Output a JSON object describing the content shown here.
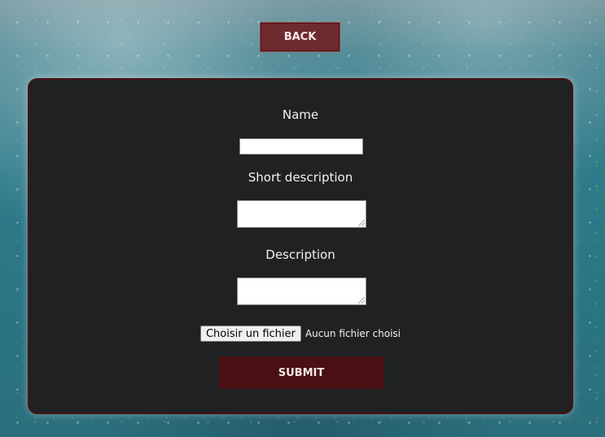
{
  "nav": {
    "back_label": "BACK"
  },
  "form": {
    "name_label": "Name",
    "name_value": "",
    "short_description_label": "Short description",
    "short_description_value": "",
    "description_label": "Description",
    "description_value": "",
    "file_button_label": "Choisir un fichier",
    "file_status": "Aucun fichier choisi",
    "submit_label": "SUBMIT"
  },
  "colors": {
    "panel_background": "#1f2123",
    "panel_border": "#4a1114",
    "back_button": "#6e2a2f",
    "submit_button": "#4a0f12",
    "water_background": "#2f7b8a"
  },
  "icons": {
    "background_texture": "underwater-bubbles"
  }
}
